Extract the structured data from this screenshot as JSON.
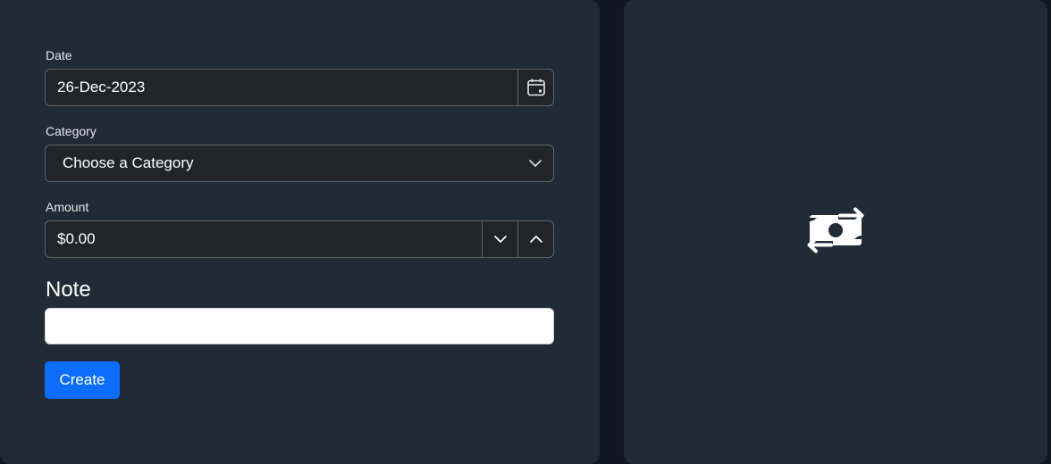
{
  "form": {
    "date": {
      "label": "Date",
      "value": "26-Dec-2023"
    },
    "category": {
      "label": "Category",
      "selected": "Choose a Category"
    },
    "amount": {
      "label": "Amount",
      "value": "$0.00"
    },
    "note": {
      "label": "Note",
      "value": ""
    },
    "create_label": "Create"
  },
  "icons": {
    "calendar": "calendar-icon",
    "dropdown": "chevron-down-icon",
    "decrement": "chevron-down-icon",
    "increment": "chevron-up-icon",
    "illustration": "money-transfer-icon"
  },
  "colors": {
    "background": "#111720",
    "panel": "#212b37",
    "input_bg": "#212529",
    "input_border": "#5c636c",
    "primary": "#0d6efd",
    "text": "#ffffff"
  }
}
